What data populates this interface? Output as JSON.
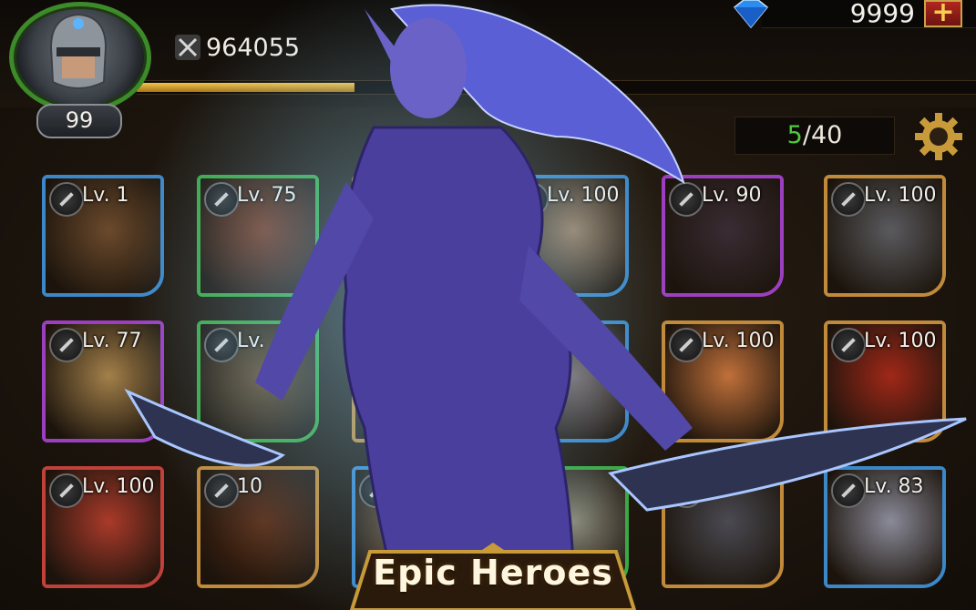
{
  "player": {
    "level": "99",
    "power": "964055",
    "xp_progress": 0.26
  },
  "currency": {
    "gems": "9999",
    "add_label": "+",
    "gem_icon": "diamond-icon"
  },
  "roster": {
    "count": "5",
    "separator": "/",
    "max": "40"
  },
  "heroes": [
    {
      "level": "Lv. 1",
      "frame": "#3b87c8"
    },
    {
      "level": "Lv. 75",
      "frame": "#3aa843"
    },
    {
      "level": "",
      "frame": "#c08a3a"
    },
    {
      "level": "Lv. 100",
      "frame": "#3b87c8"
    },
    {
      "level": "Lv. 90",
      "frame": "#9b3fc0"
    },
    {
      "level": "Lv. 100",
      "frame": "#c08a3a"
    },
    {
      "level": "Lv. 77",
      "frame": "#9b3fc0"
    },
    {
      "level": "Lv.",
      "frame": "#3aa843"
    },
    {
      "level": "",
      "frame": "#c08a3a"
    },
    {
      "level": "",
      "frame": "#3b87c8"
    },
    {
      "level": "Lv. 100",
      "frame": "#c08a3a"
    },
    {
      "level": "Lv. 100",
      "frame": "#c08a3a"
    },
    {
      "level": "Lv. 100",
      "frame": "#c0403a"
    },
    {
      "level": "10",
      "frame": "#c08a3a"
    },
    {
      "level": "",
      "frame": "#3b87c8"
    },
    {
      "level": "",
      "frame": "#3aa843"
    },
    {
      "level": "",
      "frame": "#c08a3a"
    },
    {
      "level": "Lv. 83",
      "frame": "#3b87c8"
    }
  ],
  "banner": {
    "title": "Epic Heroes"
  },
  "colors": {
    "accent_gold": "#c9a14a",
    "capacity_current": "#4fc93c",
    "avatar_ring": "#3d8a2a"
  }
}
